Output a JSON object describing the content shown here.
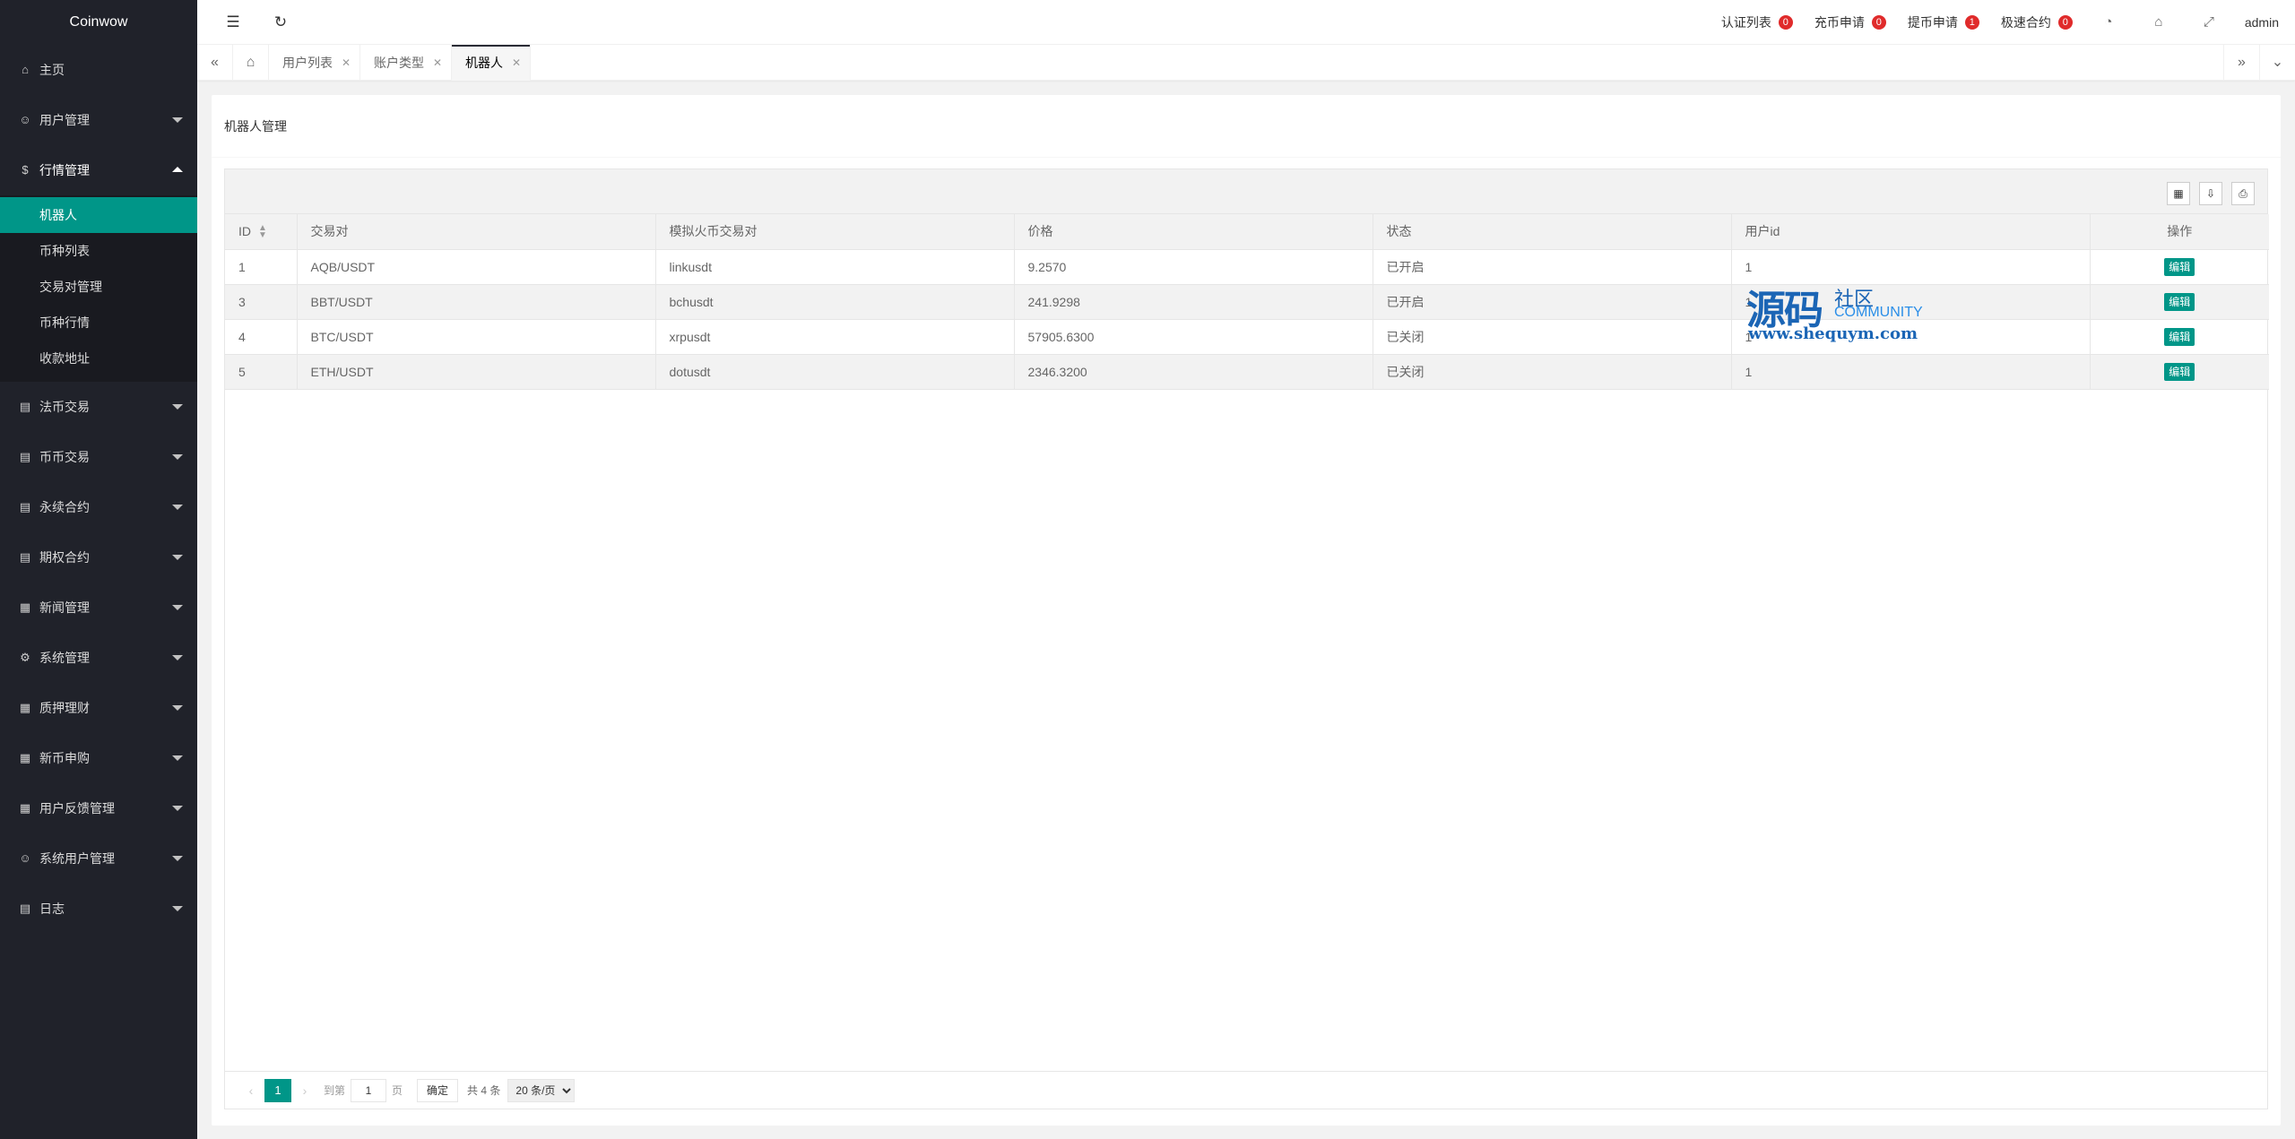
{
  "app": {
    "name": "Coinwow"
  },
  "sidebar": {
    "items": [
      {
        "label": "主页",
        "icon": "home-icon",
        "glyph": "⌂",
        "expandable": false
      },
      {
        "label": "用户管理",
        "icon": "user-icon",
        "glyph": "☺",
        "expandable": true
      },
      {
        "label": "行情管理",
        "icon": "dollar-icon",
        "glyph": "$",
        "expandable": true,
        "open": true,
        "children": [
          {
            "label": "机器人",
            "active": true
          },
          {
            "label": "币种列表"
          },
          {
            "label": "交易对管理"
          },
          {
            "label": "币种行情"
          },
          {
            "label": "收款地址"
          }
        ]
      },
      {
        "label": "法币交易",
        "icon": "file-icon",
        "glyph": "▤",
        "expandable": true
      },
      {
        "label": "币币交易",
        "icon": "file-icon",
        "glyph": "▤",
        "expandable": true
      },
      {
        "label": "永续合约",
        "icon": "file-icon",
        "glyph": "▤",
        "expandable": true
      },
      {
        "label": "期权合约",
        "icon": "file-icon",
        "glyph": "▤",
        "expandable": true
      },
      {
        "label": "新闻管理",
        "icon": "news-icon",
        "glyph": "▦",
        "expandable": true
      },
      {
        "label": "系统管理",
        "icon": "gear-icon",
        "glyph": "⚙",
        "expandable": true
      },
      {
        "label": "质押理财",
        "icon": "news-icon",
        "glyph": "▦",
        "expandable": true
      },
      {
        "label": "新币申购",
        "icon": "news-icon",
        "glyph": "▦",
        "expandable": true
      },
      {
        "label": "用户反馈管理",
        "icon": "news-icon",
        "glyph": "▦",
        "expandable": true
      },
      {
        "label": "系统用户管理",
        "icon": "user-icon",
        "glyph": "☺",
        "expandable": true
      },
      {
        "label": "日志",
        "icon": "file-icon",
        "glyph": "▤",
        "expandable": true
      }
    ]
  },
  "header": {
    "links": [
      {
        "label": "认证列表",
        "count": "0"
      },
      {
        "label": "充币申请",
        "count": "0"
      },
      {
        "label": "提币申请",
        "count": "1"
      },
      {
        "label": "极速合约",
        "count": "0"
      }
    ],
    "user": "admin"
  },
  "tabs": [
    {
      "label": "用户列表"
    },
    {
      "label": "账户类型"
    },
    {
      "label": "机器人",
      "active": true
    }
  ],
  "main": {
    "title": "机器人管理",
    "table": {
      "columns": [
        "ID",
        "交易对",
        "模拟火币交易对",
        "价格",
        "状态",
        "用户id",
        "操作"
      ],
      "rows": [
        {
          "id": "1",
          "pair": "AQB/USDT",
          "sim_pair": "linkusdt",
          "price": "9.2570",
          "status": "已开启",
          "user_id": "1",
          "action": "编辑"
        },
        {
          "id": "3",
          "pair": "BBT/USDT",
          "sim_pair": "bchusdt",
          "price": "241.9298",
          "status": "已开启",
          "user_id": "1",
          "action": "编辑"
        },
        {
          "id": "4",
          "pair": "BTC/USDT",
          "sim_pair": "xrpusdt",
          "price": "57905.6300",
          "status": "已关闭",
          "user_id": "1",
          "action": "编辑"
        },
        {
          "id": "5",
          "pair": "ETH/USDT",
          "sim_pair": "dotusdt",
          "price": "2346.3200",
          "status": "已关闭",
          "user_id": "1",
          "action": "编辑"
        }
      ]
    },
    "pagination": {
      "current": "1",
      "goto_label": "到第",
      "page_value": "1",
      "page_suffix": "页",
      "confirm": "确定",
      "total": "共 4 条",
      "page_size": "20 条/页"
    }
  },
  "watermark": {
    "big": "源码",
    "sub": "社区",
    "community": "COMMUNITY",
    "url": "www.shequym.com"
  },
  "colors": {
    "accent": "#009688",
    "sidebar_bg": "#20222a",
    "badge": "#e02b2b"
  }
}
